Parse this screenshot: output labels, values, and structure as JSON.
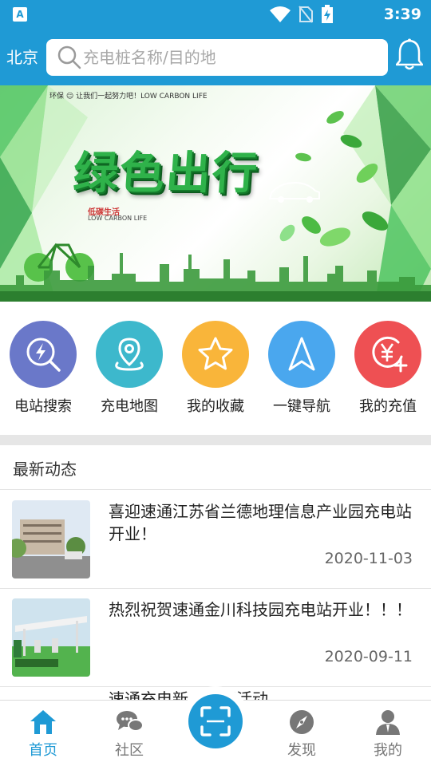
{
  "status_bar": {
    "time": "3:39",
    "app_icon": "A"
  },
  "header": {
    "city": "北京",
    "search_placeholder": "充电桩名称/目的地"
  },
  "banner": {
    "tagline": "环保 ☺ 让我们一起努力吧！LOW CARBON LIFE",
    "title": "绿色出行",
    "subtitle": "低碳生活",
    "subtitle_en": "LOW CARBON LIFE"
  },
  "quick_actions": [
    {
      "label": "电站搜索",
      "icon": "lightning-search-icon",
      "color": "#6a78c9"
    },
    {
      "label": "充电地图",
      "icon": "map-pin-icon",
      "color": "#3db8cc"
    },
    {
      "label": "我的收藏",
      "icon": "star-icon",
      "color": "#f9b53a"
    },
    {
      "label": "一键导航",
      "icon": "navigation-arrow-icon",
      "color": "#4aa7ee"
    },
    {
      "label": "我的充值",
      "icon": "yen-plus-icon",
      "color": "#ee5053"
    }
  ],
  "news": {
    "section_title": "最新动态",
    "items": [
      {
        "title": "喜迎速通江苏省兰德地理信息产业园充电站开业！",
        "date": "2020-11-03"
      },
      {
        "title": "热烈祝贺速通金川科技园充电站开业！！！",
        "date": "2020-09-11"
      },
      {
        "title": "速通充电新…优惠活动…"
      }
    ]
  },
  "tabs": [
    {
      "label": "首页",
      "icon": "home-icon",
      "active": true
    },
    {
      "label": "社区",
      "icon": "chat-bubbles-icon",
      "active": false
    },
    {
      "label": "发现",
      "icon": "compass-icon",
      "active": false
    },
    {
      "label": "我的",
      "icon": "user-icon",
      "active": false
    }
  ],
  "colors": {
    "brand": "#1F9AD5",
    "active_tab": "#1F9AD5",
    "inactive_tab": "#777777"
  }
}
